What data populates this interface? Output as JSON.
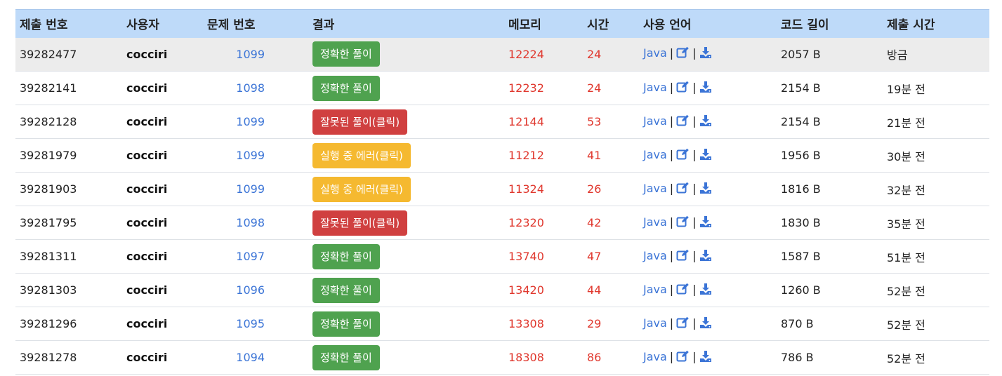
{
  "headers": {
    "submission_id": "제출 번호",
    "user": "사용자",
    "problem": "문제 번호",
    "result": "결과",
    "memory": "메모리",
    "time": "시간",
    "language": "사용 언어",
    "code_length": "코드 길이",
    "submitted_at": "제출 시간"
  },
  "colors": {
    "header_bg": "#bedaf9",
    "accepted": "#4fa24f",
    "wrong": "#d04040",
    "runtime_error": "#f5b930",
    "link": "#3b74d6",
    "stat": "#e0382e"
  },
  "icons": [
    "edit-icon",
    "download-icon"
  ],
  "rows": [
    {
      "id": "39282477",
      "user": "cocciri",
      "problem": "1099",
      "result": "정확한 풀이",
      "result_type": "ac",
      "memory": "12224",
      "time": "24",
      "language": "Java",
      "length": "2057 B",
      "submitted": "방금"
    },
    {
      "id": "39282141",
      "user": "cocciri",
      "problem": "1098",
      "result": "정확한 풀이",
      "result_type": "ac",
      "memory": "12232",
      "time": "24",
      "language": "Java",
      "length": "2154 B",
      "submitted": "19분 전"
    },
    {
      "id": "39282128",
      "user": "cocciri",
      "problem": "1099",
      "result": "잘못된 풀이(클릭)",
      "result_type": "wa",
      "memory": "12144",
      "time": "53",
      "language": "Java",
      "length": "2154 B",
      "submitted": "21분 전"
    },
    {
      "id": "39281979",
      "user": "cocciri",
      "problem": "1099",
      "result": "실행 중 에러(클릭)",
      "result_type": "re",
      "memory": "11212",
      "time": "41",
      "language": "Java",
      "length": "1956 B",
      "submitted": "30분 전"
    },
    {
      "id": "39281903",
      "user": "cocciri",
      "problem": "1099",
      "result": "실행 중 에러(클릭)",
      "result_type": "re",
      "memory": "11324",
      "time": "26",
      "language": "Java",
      "length": "1816 B",
      "submitted": "32분 전"
    },
    {
      "id": "39281795",
      "user": "cocciri",
      "problem": "1098",
      "result": "잘못된 풀이(클릭)",
      "result_type": "wa",
      "memory": "12320",
      "time": "42",
      "language": "Java",
      "length": "1830 B",
      "submitted": "35분 전"
    },
    {
      "id": "39281311",
      "user": "cocciri",
      "problem": "1097",
      "result": "정확한 풀이",
      "result_type": "ac",
      "memory": "13740",
      "time": "47",
      "language": "Java",
      "length": "1587 B",
      "submitted": "51분 전"
    },
    {
      "id": "39281303",
      "user": "cocciri",
      "problem": "1096",
      "result": "정확한 풀이",
      "result_type": "ac",
      "memory": "13420",
      "time": "44",
      "language": "Java",
      "length": "1260 B",
      "submitted": "52분 전"
    },
    {
      "id": "39281296",
      "user": "cocciri",
      "problem": "1095",
      "result": "정확한 풀이",
      "result_type": "ac",
      "memory": "13308",
      "time": "29",
      "language": "Java",
      "length": "870 B",
      "submitted": "52분 전"
    },
    {
      "id": "39281278",
      "user": "cocciri",
      "problem": "1094",
      "result": "정확한 풀이",
      "result_type": "ac",
      "memory": "18308",
      "time": "86",
      "language": "Java",
      "length": "786 B",
      "submitted": "52분 전"
    }
  ]
}
